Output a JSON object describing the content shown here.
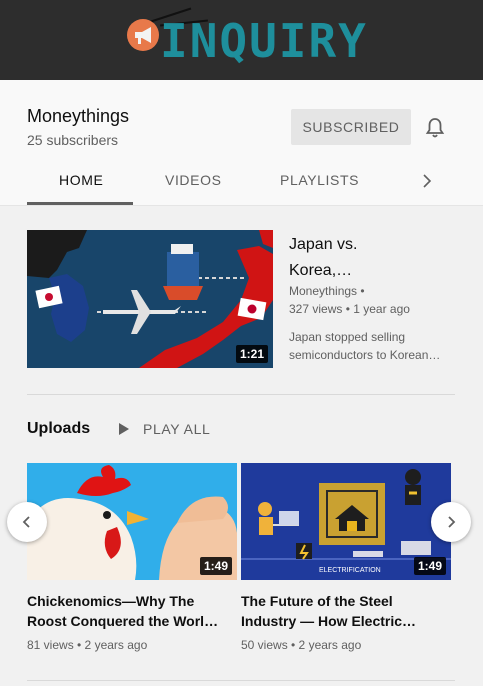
{
  "banner": {
    "logo_text": "INQUIRY",
    "colors": {
      "background": "#2d2d2d",
      "logo": "#1e8f9c",
      "megaphone": "#e8794a"
    }
  },
  "channel": {
    "name": "Moneythings",
    "subscribers": "25 subscribers",
    "subscribe_label": "SUBSCRIBED"
  },
  "tabs": [
    {
      "label": "HOME",
      "active": true
    },
    {
      "label": "VIDEOS",
      "active": false
    },
    {
      "label": "PLAYLISTS",
      "active": false
    }
  ],
  "featured": {
    "title_line1": "Japan vs.",
    "title_line2": "Korea,…",
    "channel": "Moneythings •",
    "meta": "327 views • 1 year ago",
    "description_line1": "Japan stopped selling",
    "description_line2": "semiconductors to Korean…",
    "duration": "1:21"
  },
  "uploads": {
    "title": "Uploads",
    "play_all_label": "PLAY ALL",
    "videos": [
      {
        "title_line1": "Chickenomics—Why The",
        "title_line2": "Roost Conquered the Worl…",
        "meta": "81 views • 2 years ago",
        "duration": "1:49"
      },
      {
        "title_line1": "The Future of the Steel",
        "title_line2": "Industry — How Electric…",
        "meta": "50 views • 2 years ago",
        "duration": "1:49",
        "thumb_caption": "ELECTRIFICATION"
      }
    ]
  }
}
